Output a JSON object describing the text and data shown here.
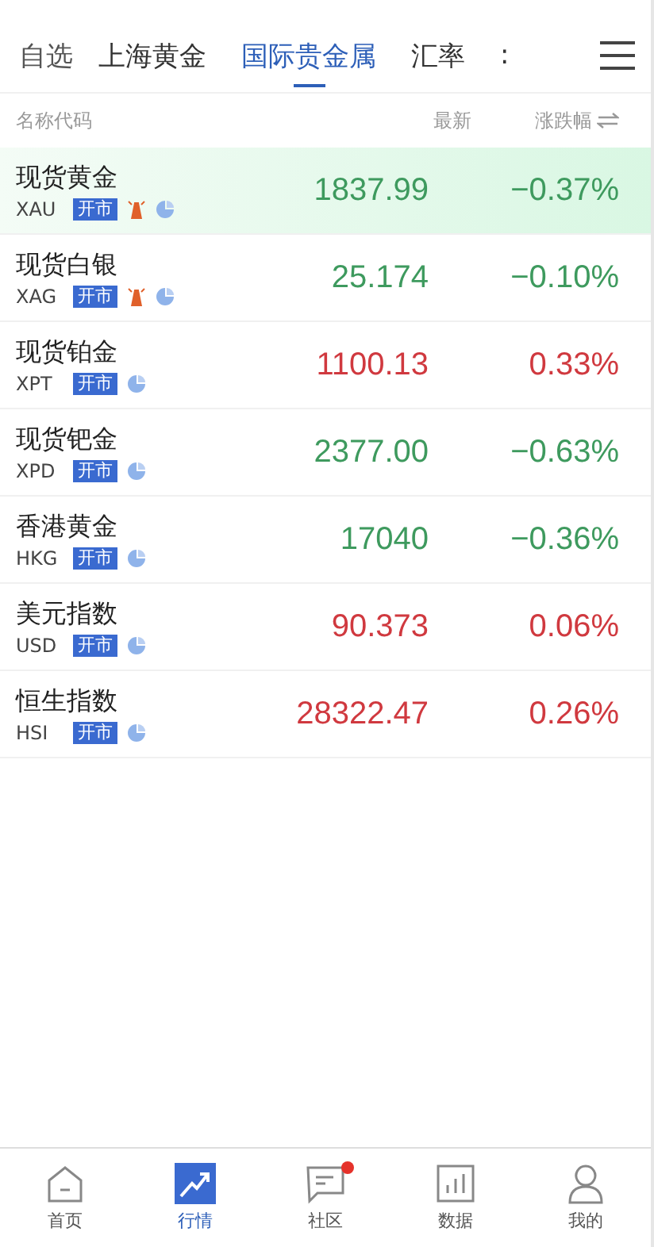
{
  "tabs": [
    {
      "label": "自选",
      "selected": false
    },
    {
      "label": "上海黄金",
      "selected": false
    },
    {
      "label": "国际贵金属",
      "selected": true
    },
    {
      "label": "汇率",
      "selected": false
    },
    {
      "label": ":",
      "selected": false
    }
  ],
  "header": {
    "name": "名称代码",
    "price": "最新",
    "change": "涨跌幅"
  },
  "rows": [
    {
      "name": "现货黄金",
      "code": "XAU",
      "status": "开市",
      "alert": true,
      "color": "#3e9a5e",
      "price": "1837.99",
      "change": "−0.37%",
      "selected": true
    },
    {
      "name": "现货白银",
      "code": "XAG",
      "status": "开市",
      "alert": true,
      "color": "#3e9a5e",
      "price": "25.174",
      "change": "−0.10%",
      "selected": false
    },
    {
      "name": "现货铂金",
      "code": "XPT",
      "status": "开市",
      "alert": false,
      "color": "#d0393f",
      "price": "1100.13",
      "change": "0.33%",
      "selected": false
    },
    {
      "name": "现货钯金",
      "code": "XPD",
      "status": "开市",
      "alert": false,
      "color": "#3e9a5e",
      "price": "2377.00",
      "change": "−0.63%",
      "selected": false
    },
    {
      "name": "香港黄金",
      "code": "HKG",
      "status": "开市",
      "alert": false,
      "color": "#3e9a5e",
      "price": "17040",
      "change": "−0.36%",
      "selected": false
    },
    {
      "name": "美元指数",
      "code": "USD",
      "status": "开市",
      "alert": false,
      "color": "#d0393f",
      "price": "90.373",
      "change": "0.06%",
      "selected": false
    },
    {
      "name": "恒生指数",
      "code": "HSI",
      "status": "开市",
      "alert": false,
      "color": "#d0393f",
      "price": "28322.47",
      "change": "0.26%",
      "selected": false
    }
  ],
  "nav": [
    {
      "kind": "home",
      "label": "首页",
      "selected": false,
      "badge": false
    },
    {
      "kind": "market",
      "label": "行情",
      "selected": true,
      "badge": false
    },
    {
      "kind": "community",
      "label": "社区",
      "selected": false,
      "badge": true
    },
    {
      "kind": "data",
      "label": "数据",
      "selected": false,
      "badge": false
    },
    {
      "kind": "profile",
      "label": "我的",
      "selected": false,
      "badge": false
    }
  ]
}
